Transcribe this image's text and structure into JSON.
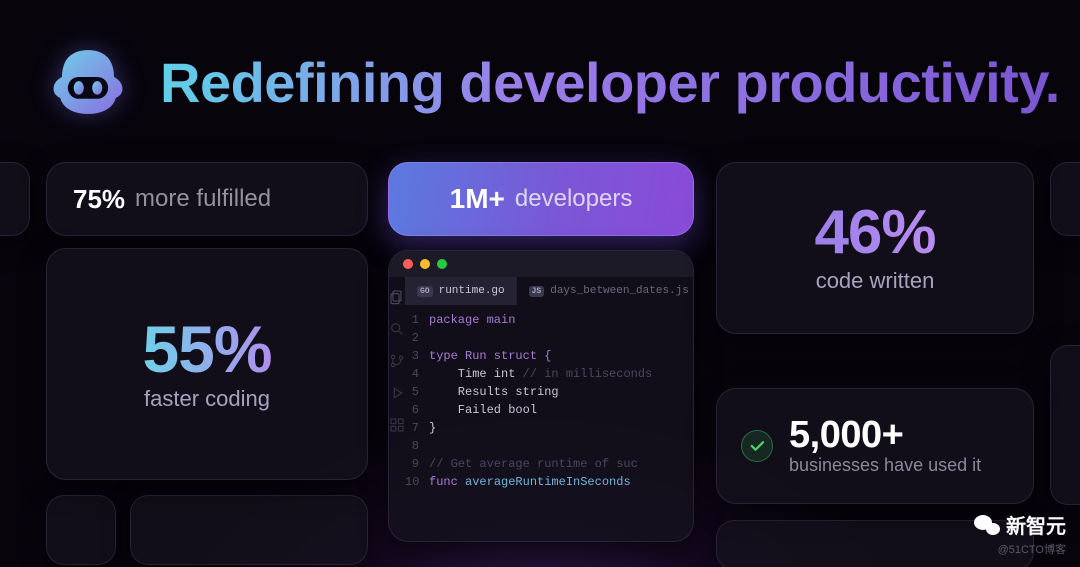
{
  "headline": "Redefining developer productivity.",
  "stats": {
    "fulfilled": {
      "value": "75%",
      "label": "more fulfilled"
    },
    "faster": {
      "value": "55%",
      "label": "faster coding"
    },
    "highlight": {
      "value": "1M+",
      "label": "developers"
    },
    "written": {
      "value": "46%",
      "label": "code written"
    },
    "biz": {
      "value": "5,000+",
      "label": "businesses have used it"
    }
  },
  "editor": {
    "active_tab": "runtime.go",
    "active_lang": "GO",
    "inactive_tab": "days_between_dates.js",
    "inactive_lang": "JS",
    "code": {
      "l1": "package main",
      "l3": "type Run struct {",
      "l4": "    Time int // in milliseconds",
      "l4a": "    Time int",
      "l4b": " // in milliseconds",
      "l5": "    Results string",
      "l6": "    Failed bool",
      "l7": "}",
      "l9": "// Get average runtime of suc",
      "l10": "func averageRuntimeInSeconds",
      "l10k": "func ",
      "l10f": "averageRuntimeInSeconds"
    }
  },
  "watermark": {
    "name": "新智元",
    "sub": "@51CTO博客"
  }
}
